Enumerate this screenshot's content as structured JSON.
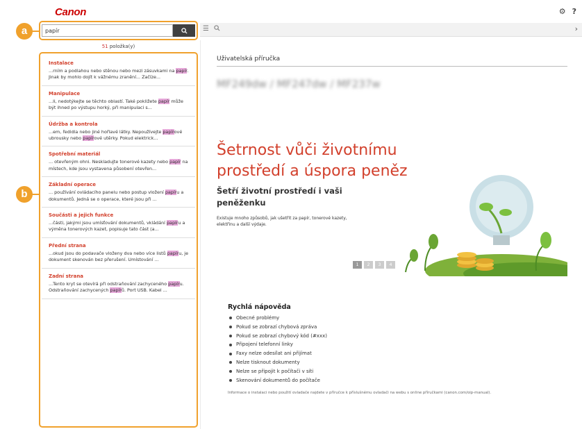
{
  "brand": {
    "logo": "Canon"
  },
  "callouts": {
    "a": "a",
    "b": "b"
  },
  "top_icons": {
    "settings": "⚙",
    "help": "?"
  },
  "search": {
    "value": "papír",
    "button_icon": "search-icon"
  },
  "toolbar": {
    "icons": [
      "list-icon",
      "search-icon"
    ],
    "chevron": "›"
  },
  "hits": {
    "count": "51",
    "label": " položka(y)"
  },
  "results": [
    {
      "title": "Instalace",
      "snippet": [
        "...rním a podlahou nebo stěnou nebo mezi zásuvkami na ",
        "papír",
        ". Jinak by mohlo dojít k vážnému zranění... Začíze..."
      ]
    },
    {
      "title": "Manipulace",
      "snippet": [
        "...li, nedotýkejte se těchto oblastí. Také pokližete ",
        "papír",
        " může být ihned po výstupu horký, při manipulaci s..."
      ]
    },
    {
      "title": "Údržba a kontrola",
      "snippet": [
        "...em, ředidla nebo jiné hořlavé látky. Nepoužívejte ",
        "papír",
        "ové ubrousky nebo ",
        "papír",
        "ové utěrky. Pokud elektrick..."
      ]
    },
    {
      "title": "Spotřební materiál",
      "snippet": [
        "... otevřeným ohni. Neskladujte tonerové kazety nebo ",
        "papír",
        " na místech, kde jsou vystavena působení otevřen..."
      ]
    },
    {
      "title": "Základní operace",
      "snippet": [
        "... používání ovládacího panelu nebo postup vložení ",
        "papír",
        "u a dokumentů. Jedná se o operace, které jsou při ..."
      ]
    },
    {
      "title": "Součásti a jejich funkce",
      "snippet": [
        "...části, jakými jsou umísťování dokumentů, vkládání ",
        "papír",
        "u a výměna tonerových kazet, popisuje tato část (a..."
      ]
    },
    {
      "title": "Přední strana",
      "snippet": [
        "...okud jsou do podavače vloženy dva nebo více listů ",
        "papír",
        "u, je dokument skenován bez přerušení. Umístování ..."
      ]
    },
    {
      "title": "Zadní strana",
      "snippet": [
        "...Tento kryt se otevírá při odstraňování zachyceného ",
        "papír",
        "u. Odstraňování zachycených ",
        "papír",
        "ů. Port USB. Kabel ..."
      ]
    }
  ],
  "main": {
    "heading": "Uživatelská příručka",
    "model": "MF249dw / MF247dw / MF237w",
    "banner": {
      "title": "Šetrnost vůči životnímu prostředí a úspora peněz",
      "subtitle": "Šetří životní prostředí i vaši peněženku",
      "text": "Existuje mnoho způsobů, jak ušetřit za papír, tonerové kazety, elektřinu a další výdaje.",
      "dots": [
        "1",
        "2",
        "3",
        "4"
      ],
      "active_dot": 0
    },
    "quick_help": {
      "title": "Rychlá nápověda",
      "items": [
        "Obecné problémy",
        "Pokud se zobrazí chybová zpráva",
        "Pokud se zobrazí chybový kód (#xxx)",
        "Připojení telefonní linky",
        "Faxy nelze odesílat ani přijímat",
        "Nelze tisknout dokumenty",
        "Nelze se připojit k počítači v síti",
        "Skenování dokumentů do počítače"
      ],
      "note": "Informace o instalaci nebo použití ovladače najdete v příručce k příslušnému ovladači na webu s online příručkami (canon.com/oip-manual)."
    }
  },
  "colors": {
    "accent": "#f0a12c",
    "brand": "#cc0000",
    "result_title": "#d2402c",
    "highlight": "#e6a7d9"
  }
}
